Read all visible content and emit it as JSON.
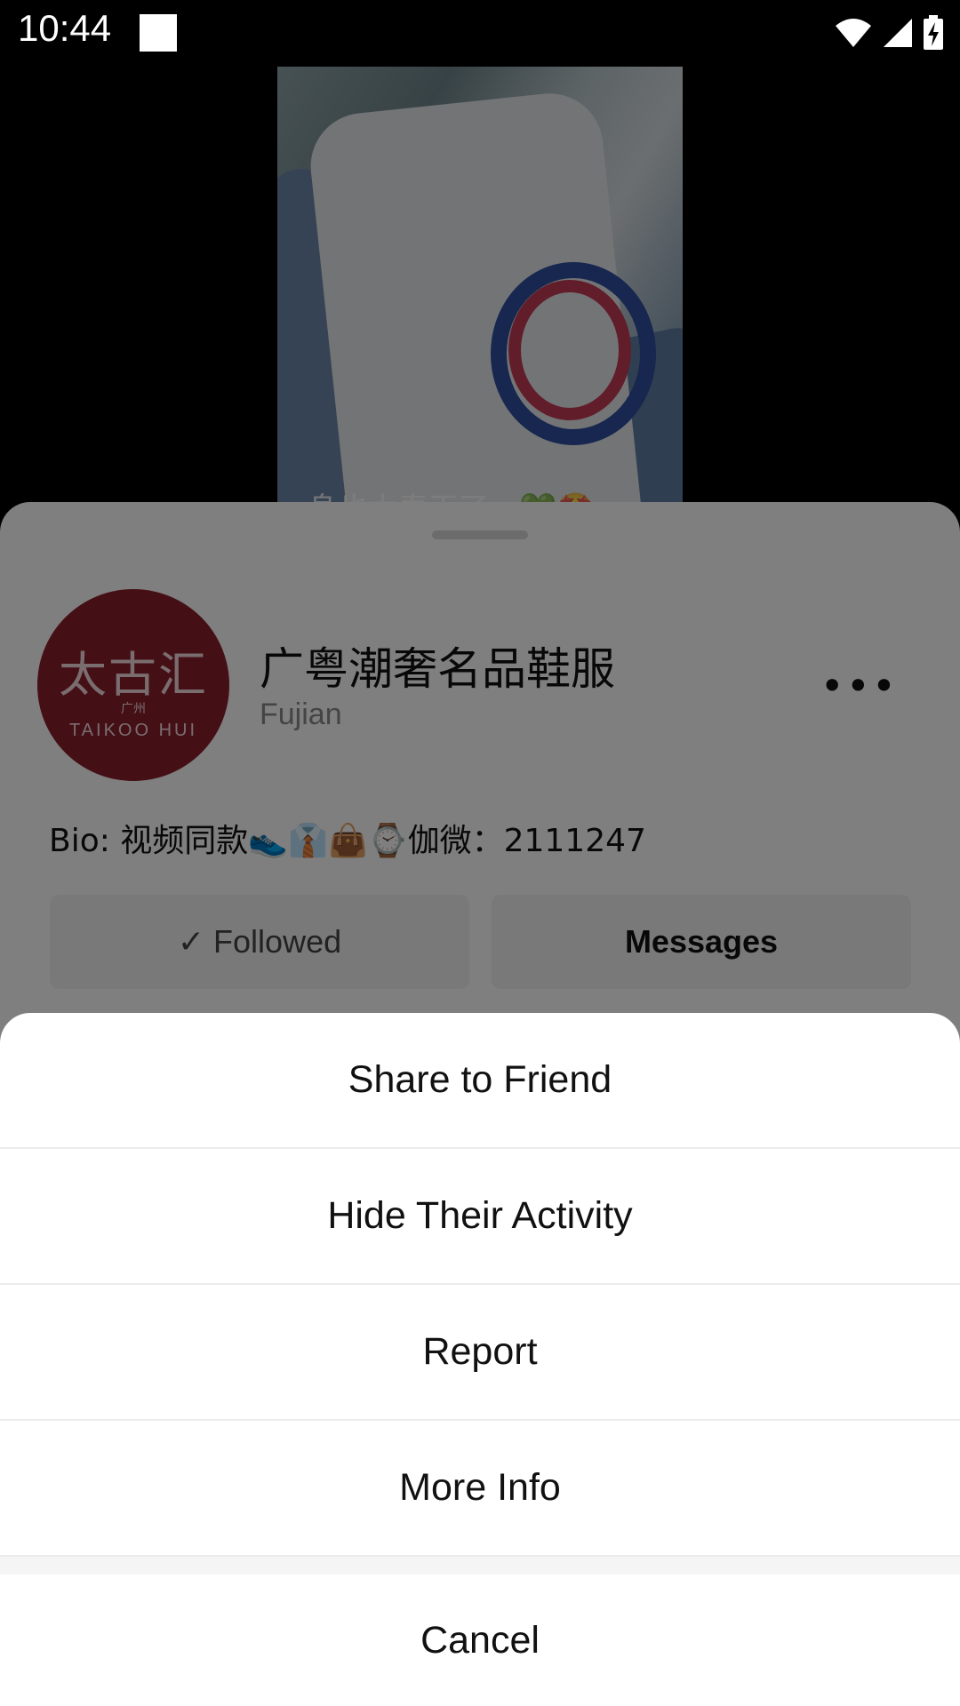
{
  "status_bar": {
    "time": "10:44"
  },
  "video": {
    "caption": "一身也太春天了～💚🤩"
  },
  "profile": {
    "avatar_text": {
      "main": "太古汇",
      "sub": "广州",
      "brand": "TAIKOO HUI"
    },
    "name": "广粤潮奢名品鞋服",
    "region": "Fujian",
    "bio": "Bio: 视频同款👟👔👜⌚伽微：2111247",
    "followed_label": "✓ Followed",
    "messages_label": "Messages"
  },
  "action_sheet": {
    "items": [
      {
        "label": "Share to Friend"
      },
      {
        "label": "Hide Their Activity"
      },
      {
        "label": "Report"
      },
      {
        "label": "More Info"
      }
    ],
    "cancel_label": "Cancel"
  }
}
